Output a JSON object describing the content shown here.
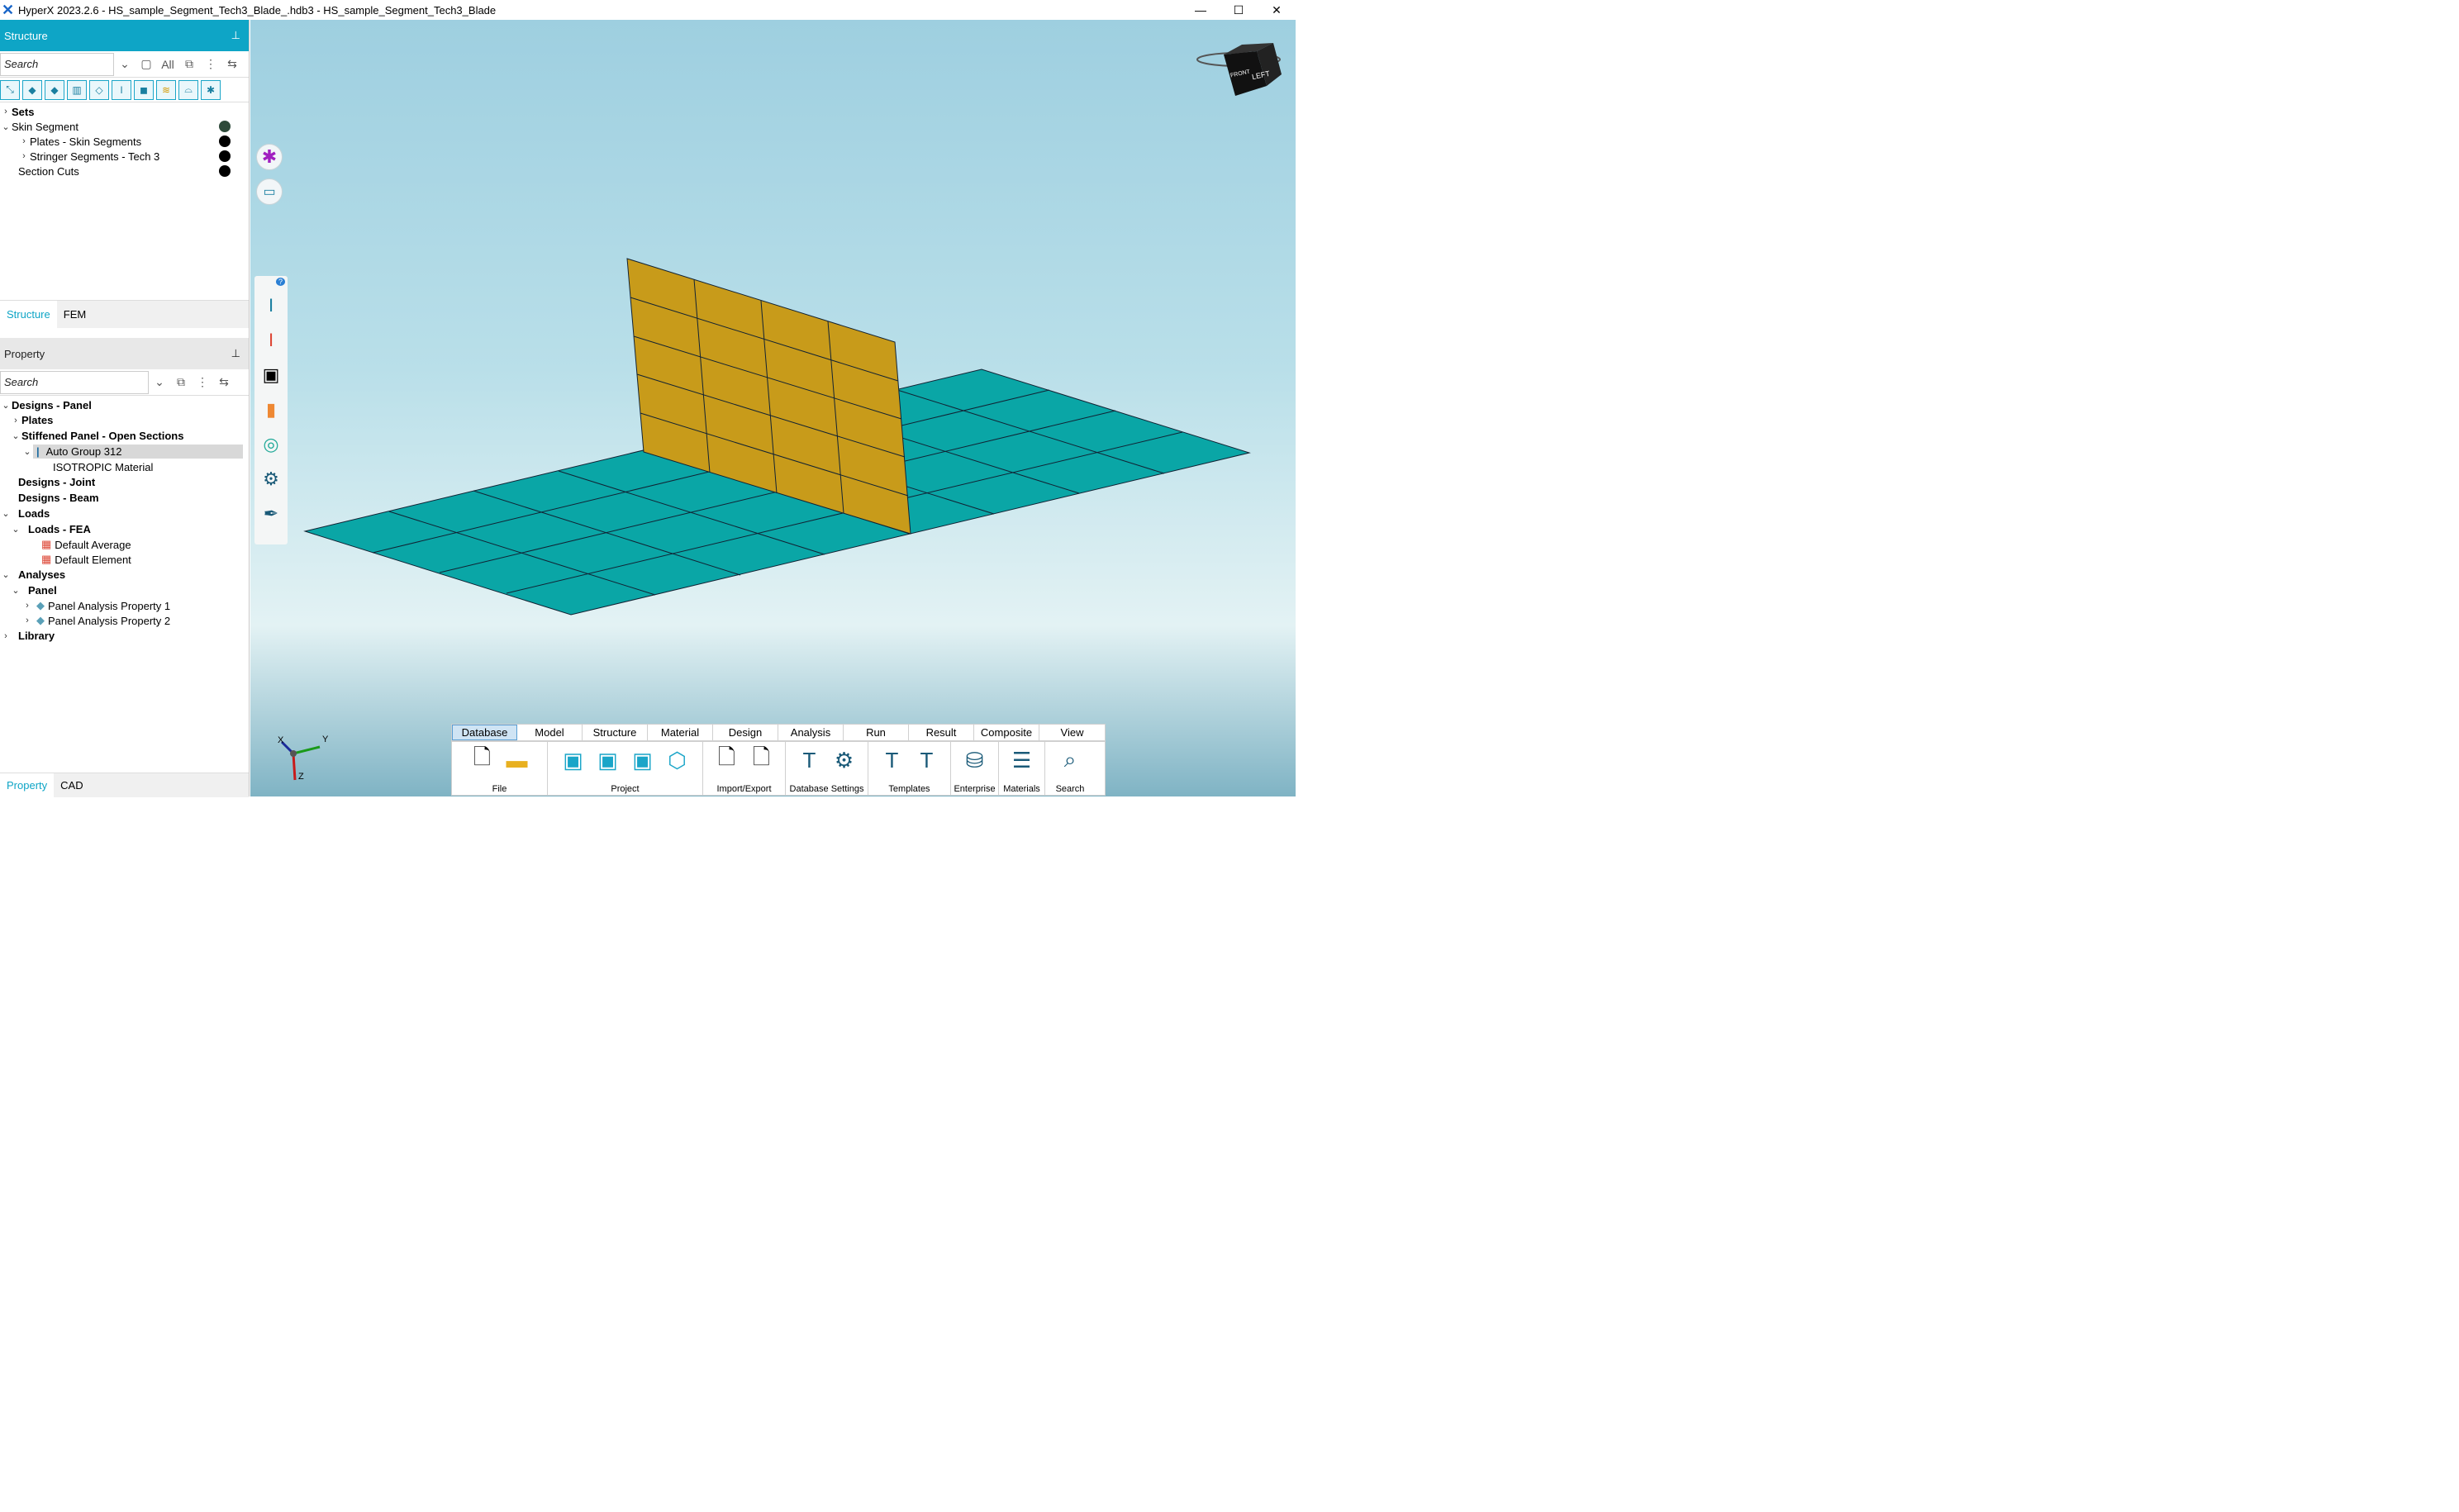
{
  "window": {
    "title": "HyperX 2023.2.6 - HS_sample_Segment_Tech3_Blade_.hdb3 - HS_sample_Segment_Tech3_Blade",
    "minimize": "—",
    "maximize": "☐",
    "close": "✕"
  },
  "structure_pane": {
    "title": "Structure",
    "pin": "⊥",
    "search_placeholder": "Search",
    "filter_all": "All",
    "tree": [
      {
        "label": "Sets",
        "bold": true,
        "expanded": false
      },
      {
        "label": "Skin Segment",
        "expanded": true,
        "dot": "green"
      },
      {
        "label": "Plates - Skin Segments",
        "dot": "black"
      },
      {
        "label": "Stringer Segments - Tech 3",
        "dot": "black"
      },
      {
        "label": "Section Cuts",
        "dot": "black"
      }
    ],
    "tabs": [
      "Structure",
      "FEM"
    ]
  },
  "property_pane": {
    "title": "Property",
    "pin": "⊥",
    "search_placeholder": "Search",
    "tree": [
      {
        "label": "Designs - Panel"
      },
      {
        "label": "Plates"
      },
      {
        "label": "Stiffened Panel - Open Sections"
      },
      {
        "label": "Auto Group 312"
      },
      {
        "label": "ISOTROPIC Material"
      },
      {
        "label": "Designs - Joint"
      },
      {
        "label": "Designs - Beam"
      },
      {
        "label": "Loads"
      },
      {
        "label": "Loads - FEA"
      },
      {
        "label": "Default Average"
      },
      {
        "label": "Default Element"
      },
      {
        "label": "Analyses"
      },
      {
        "label": "Panel"
      },
      {
        "label": "Panel Analysis Property 1"
      },
      {
        "label": "Panel Analysis Property 2"
      },
      {
        "label": "Library"
      }
    ],
    "tabs": [
      "Property",
      "CAD"
    ]
  },
  "viewport": {
    "view_cube_faces": [
      "FRONT",
      "LEFT"
    ],
    "axis_labels": {
      "x": "X",
      "y": "Y",
      "z": "Z"
    },
    "colors": {
      "skin": "#0aa6a6",
      "blade": "#c89b1a",
      "mesh_line": "#123"
    }
  },
  "ribbon": {
    "tabs": [
      "Database",
      "Model",
      "Structure",
      "Material",
      "Design",
      "Analysis",
      "Run",
      "Result",
      "Composite",
      "View"
    ],
    "active_tab": "Database",
    "groups": [
      "File",
      "Project",
      "Import/Export",
      "Database Settings",
      "Templates",
      "Enterprise",
      "Materials",
      "Search"
    ]
  },
  "accent": "#0ea5c6"
}
